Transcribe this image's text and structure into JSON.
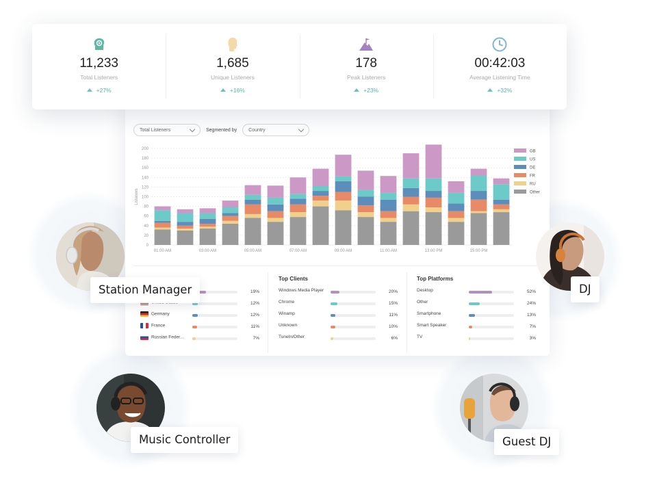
{
  "stats": [
    {
      "icon": "headphones-head-icon",
      "value": "11,233",
      "label": "Total Listeners",
      "change": "+27%",
      "color": "#5fb9a2"
    },
    {
      "icon": "head-silhouette-icon",
      "value": "1,685",
      "label": "Unique Listeners",
      "change": "+16%",
      "color": "#f4d9a8"
    },
    {
      "icon": "mountain-flag-icon",
      "value": "178",
      "label": "Peak Listeners",
      "change": "+23%",
      "color": "#a581c4"
    },
    {
      "icon": "clock-icon",
      "value": "00:42:03",
      "label": "Average Listening Time",
      "change": "+32%",
      "color": "#7fb6d6"
    }
  ],
  "filters": {
    "metric": "Total Listeners",
    "segmented_by_label": "Segmented by",
    "segment": "Country"
  },
  "chart_data": {
    "type": "bar",
    "stacked": true,
    "ylabel": "Listeners",
    "ylim": [
      0,
      200
    ],
    "yticks": [
      0,
      20,
      40,
      60,
      80,
      100,
      120,
      140,
      160,
      180,
      200
    ],
    "x_tick_labels": [
      "01:00 AM",
      "03:00 AM",
      "05:00 AM",
      "07:00 AM",
      "09:00 AM",
      "11:00 AM",
      "13:00 PM",
      "15:00 PM"
    ],
    "bar_count": 16,
    "legend_position": "right",
    "series": [
      {
        "name": "Other",
        "color": "#9a9a9a",
        "values": [
          32,
          30,
          34,
          44,
          56,
          48,
          58,
          80,
          72,
          58,
          48,
          70,
          68,
          48,
          66,
          68
        ]
      },
      {
        "name": "RU",
        "color": "#f0d08a",
        "values": [
          4,
          4,
          4,
          6,
          8,
          8,
          10,
          12,
          20,
          10,
          8,
          14,
          10,
          8,
          4,
          6
        ]
      },
      {
        "name": "FR",
        "color": "#e98a66",
        "values": [
          10,
          6,
          6,
          10,
          20,
          14,
          16,
          10,
          18,
          14,
          14,
          16,
          20,
          14,
          24,
          10
        ]
      },
      {
        "name": "DE",
        "color": "#5d8dba",
        "values": [
          4,
          8,
          10,
          6,
          10,
          14,
          12,
          10,
          22,
          18,
          24,
          18,
          14,
          16,
          18,
          10
        ]
      },
      {
        "name": "US",
        "color": "#6ccac8",
        "values": [
          22,
          18,
          12,
          12,
          10,
          14,
          10,
          10,
          10,
          14,
          14,
          20,
          26,
          22,
          32,
          32
        ]
      },
      {
        "name": "GB",
        "color": "#cc98c6",
        "values": [
          8,
          8,
          10,
          14,
          20,
          25,
          34,
          36,
          45,
          40,
          35,
          52,
          70,
          24,
          14,
          12
        ]
      }
    ]
  },
  "top_countries": [
    {
      "name": "",
      "pct": "19%",
      "fill": 0.3,
      "color": "#b58fc4",
      "flag": "none"
    },
    {
      "name": "United States",
      "pct": "12%",
      "fill": 0.12,
      "color": "#6ccac8",
      "flag": "us"
    },
    {
      "name": "Germany",
      "pct": "12%",
      "fill": 0.12,
      "color": "#5d8dba",
      "flag": "de"
    },
    {
      "name": "France",
      "pct": "11%",
      "fill": 0.11,
      "color": "#e98a66",
      "flag": "fr"
    },
    {
      "name": "Russian Feder...",
      "pct": "7%",
      "fill": 0.07,
      "color": "#f0d08a",
      "flag": "ru"
    }
  ],
  "top_clients": {
    "title": "Top Clients",
    "rows": [
      {
        "name": "Windows Media Player",
        "pct": "20%",
        "fill": 0.2,
        "color": "#b58fc4"
      },
      {
        "name": "Chrome",
        "pct": "15%",
        "fill": 0.15,
        "color": "#6ccac8"
      },
      {
        "name": "Winamp",
        "pct": "11%",
        "fill": 0.11,
        "color": "#5d8dba"
      },
      {
        "name": "Unknown",
        "pct": "10%",
        "fill": 0.1,
        "color": "#e98a66"
      },
      {
        "name": "TuneIn/Other",
        "pct": "6%",
        "fill": 0.06,
        "color": "#f0d08a"
      }
    ]
  },
  "top_platforms": {
    "title": "Top Platforms",
    "rows": [
      {
        "name": "Desktop",
        "pct": "52%",
        "fill": 0.52,
        "color": "#b58fc4"
      },
      {
        "name": "Other",
        "pct": "24%",
        "fill": 0.24,
        "color": "#6ccac8"
      },
      {
        "name": "Smartphone",
        "pct": "13%",
        "fill": 0.13,
        "color": "#5d8dba"
      },
      {
        "name": "Smart Speaker",
        "pct": "7%",
        "fill": 0.07,
        "color": "#e98a66"
      },
      {
        "name": "TV",
        "pct": "3%",
        "fill": 0.03,
        "color": "#f0d08a"
      }
    ]
  },
  "roles": {
    "station_manager": "Station Manager",
    "dj": "DJ",
    "music_controller": "Music Controller",
    "guest_dj": "Guest DJ"
  }
}
